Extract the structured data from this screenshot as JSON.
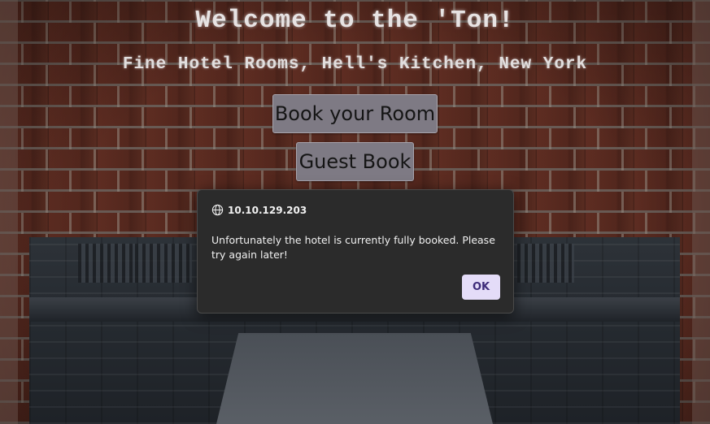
{
  "page": {
    "title": "Welcome to the 'Ton!",
    "subtitle": "Fine Hotel Rooms, Hell's Kitchen, New York"
  },
  "buttons": {
    "book_room": "Book your Room",
    "guest_book": "Guest Book"
  },
  "alert_dialog": {
    "origin": "10.10.129.203",
    "origin_icon": "globe-icon",
    "message": "Unfortunately the hotel is currently fully booked. Please try again later!",
    "ok_label": "OK",
    "ok_bg_color": "#e4dcf8",
    "ok_text_color": "#3d2b79"
  }
}
